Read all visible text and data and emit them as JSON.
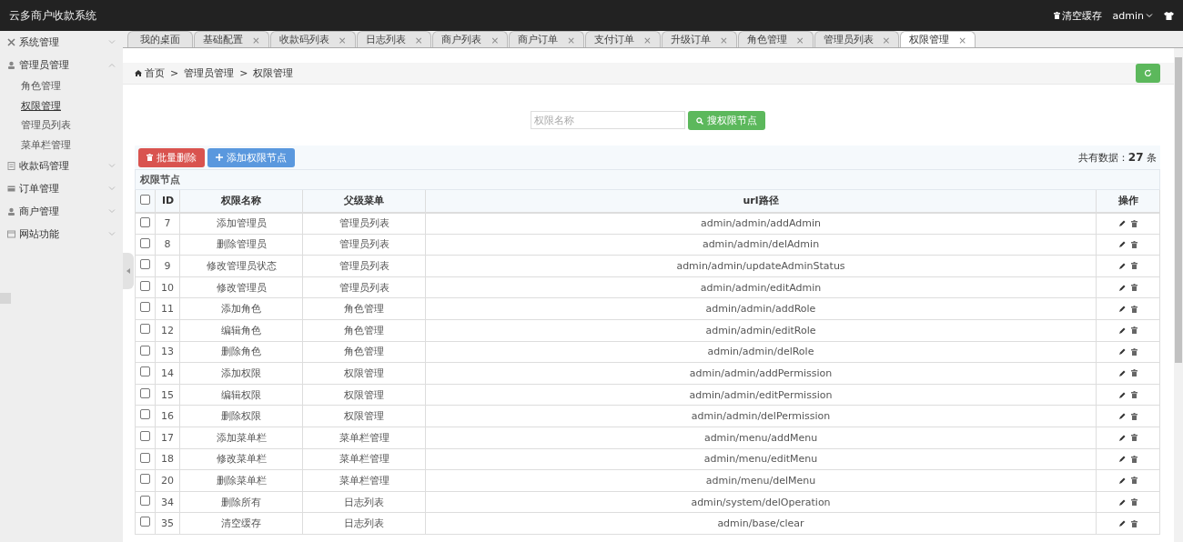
{
  "header": {
    "title": "云多商户收款系统",
    "clear_cache": "清空缓存",
    "user": "admin"
  },
  "sidebar": {
    "items": [
      {
        "label": "系统管理",
        "expanded": false
      },
      {
        "label": "管理员管理",
        "expanded": true,
        "children": [
          {
            "label": "角色管理",
            "selected": false
          },
          {
            "label": "权限管理",
            "selected": true
          },
          {
            "label": "管理员列表",
            "selected": false
          },
          {
            "label": "菜单栏管理",
            "selected": false
          }
        ]
      },
      {
        "label": "收款码管理",
        "expanded": false
      },
      {
        "label": "订单管理",
        "expanded": false
      },
      {
        "label": "商户管理",
        "expanded": false
      },
      {
        "label": "网站功能",
        "expanded": false
      }
    ]
  },
  "tabs": [
    {
      "label": "我的桌面",
      "selected": false
    },
    {
      "label": "基础配置",
      "close": "×",
      "selected": false
    },
    {
      "label": "收款码列表",
      "close": "×",
      "selected": false
    },
    {
      "label": "日志列表",
      "close": "×",
      "selected": false
    },
    {
      "label": "商户列表",
      "close": "×",
      "selected": false
    },
    {
      "label": "商户订单",
      "close": "×",
      "selected": false
    },
    {
      "label": "支付订单",
      "close": "×",
      "selected": false
    },
    {
      "label": "升级订单",
      "close": "×",
      "selected": false
    },
    {
      "label": "角色管理",
      "close": "×",
      "selected": false
    },
    {
      "label": "管理员列表",
      "close": "×",
      "selected": false
    },
    {
      "label": "权限管理",
      "close": "×",
      "selected": true
    }
  ],
  "breadcrumb": [
    "首页",
    "管理员管理",
    "权限管理"
  ],
  "breadcrumb_separator": ">",
  "search": {
    "placeholder": "权限名称",
    "button": "搜权限节点"
  },
  "toolbar": {
    "delete_button": "批量删除",
    "add_button": "添加权限节点",
    "total_label": "共有数据：",
    "total": "27",
    "total_unit": "条"
  },
  "table": {
    "caption": "权限节点",
    "select_all_checked": false,
    "columns": [
      "ID",
      "权限名称",
      "父级菜单",
      "url路径",
      "操作"
    ],
    "rows": [
      {
        "checked": false,
        "id": "7",
        "name": "添加管理员",
        "parent": "管理员列表",
        "url": "admin/admin/addAdmin"
      },
      {
        "checked": false,
        "id": "8",
        "name": "删除管理员",
        "parent": "管理员列表",
        "url": "admin/admin/delAdmin"
      },
      {
        "checked": false,
        "id": "9",
        "name": "修改管理员状态",
        "parent": "管理员列表",
        "url": "admin/admin/updateAdminStatus"
      },
      {
        "checked": false,
        "id": "10",
        "name": "修改管理员",
        "parent": "管理员列表",
        "url": "admin/admin/editAdmin"
      },
      {
        "checked": false,
        "id": "11",
        "name": "添加角色",
        "parent": "角色管理",
        "url": "admin/admin/addRole"
      },
      {
        "checked": false,
        "id": "12",
        "name": "编辑角色",
        "parent": "角色管理",
        "url": "admin/admin/editRole"
      },
      {
        "checked": false,
        "id": "13",
        "name": "删除角色",
        "parent": "角色管理",
        "url": "admin/admin/delRole"
      },
      {
        "checked": false,
        "id": "14",
        "name": "添加权限",
        "parent": "权限管理",
        "url": "admin/admin/addPermission"
      },
      {
        "checked": false,
        "id": "15",
        "name": "编辑权限",
        "parent": "权限管理",
        "url": "admin/admin/editPermission"
      },
      {
        "checked": false,
        "id": "16",
        "name": "删除权限",
        "parent": "权限管理",
        "url": "admin/admin/delPermission"
      },
      {
        "checked": false,
        "id": "17",
        "name": "添加菜单栏",
        "parent": "菜单栏管理",
        "url": "admin/menu/addMenu"
      },
      {
        "checked": false,
        "id": "18",
        "name": "修改菜单栏",
        "parent": "菜单栏管理",
        "url": "admin/menu/editMenu"
      },
      {
        "checked": false,
        "id": "20",
        "name": "删除菜单栏",
        "parent": "菜单栏管理",
        "url": "admin/menu/delMenu"
      },
      {
        "checked": false,
        "id": "34",
        "name": "删除所有",
        "parent": "日志列表",
        "url": "admin/system/delOperation"
      },
      {
        "checked": false,
        "id": "35",
        "name": "清空缓存",
        "parent": "日志列表",
        "url": "admin/base/clear"
      }
    ]
  }
}
